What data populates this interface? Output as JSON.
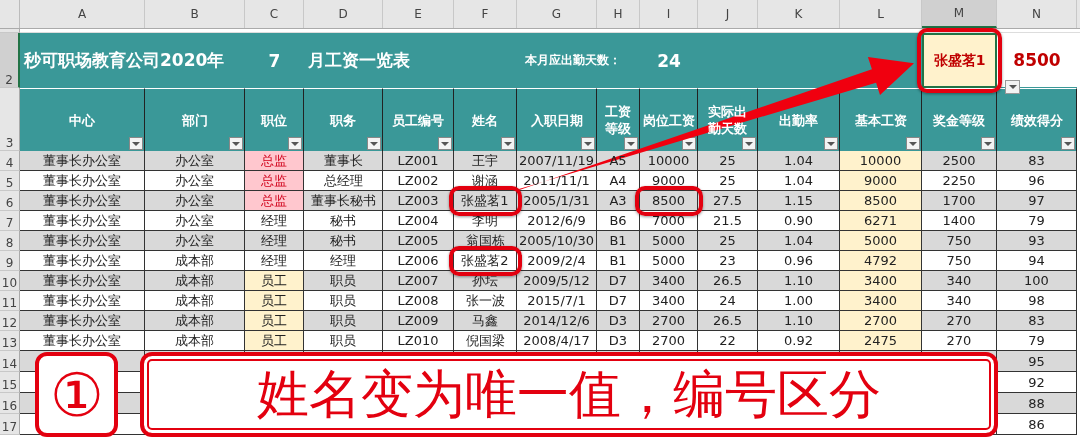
{
  "column_headers": [
    {
      "label": "A",
      "selected": false
    },
    {
      "label": "B",
      "selected": false
    },
    {
      "label": "C",
      "selected": false
    },
    {
      "label": "D",
      "selected": false
    },
    {
      "label": "E",
      "selected": false
    },
    {
      "label": "F",
      "selected": false
    },
    {
      "label": "G",
      "selected": false
    },
    {
      "label": "H",
      "selected": false
    },
    {
      "label": "I",
      "selected": false
    },
    {
      "label": "J",
      "selected": false
    },
    {
      "label": "K",
      "selected": false
    },
    {
      "label": "L",
      "selected": false
    },
    {
      "label": "M",
      "selected": true
    },
    {
      "label": "N",
      "selected": false
    }
  ],
  "title_row": {
    "row_number": "2",
    "selected": true,
    "items": [
      {
        "kind": "title",
        "text": "秒可职场教育公司2020年"
      },
      {
        "kind": "value",
        "text": "7"
      },
      {
        "kind": "title",
        "text": "月工资一览表"
      },
      {
        "kind": "label",
        "text": "本月应出勤天数："
      },
      {
        "kind": "value",
        "text": "24"
      }
    ],
    "lookup_cell": {
      "text": "张盛茗1",
      "selected": true,
      "ringed": true,
      "arrow_to": true
    },
    "result_cell": {
      "text": "8500"
    }
  },
  "header_row": {
    "row_number": "3",
    "columns": [
      "中心",
      "部门",
      "职位",
      "职务",
      "员工编号",
      "姓名",
      "入职日期",
      "工资等级",
      "岗位工资",
      "实际出勤天数",
      "出勤率",
      "基本工资",
      "奖金等级",
      "绩效得分"
    ]
  },
  "rows": [
    {
      "row_number": "4",
      "shaded": true,
      "cells": [
        "董事长办公室",
        "办公室",
        {
          "text": "总监",
          "flagged": true
        },
        "董事长",
        "LZ001",
        "王宇",
        "2007/11/19",
        "A5",
        "10000",
        "25",
        "1.04",
        "10000",
        "2500",
        "83"
      ]
    },
    {
      "row_number": "5",
      "shaded": false,
      "cells": [
        "董事长办公室",
        "办公室",
        {
          "text": "总监",
          "flagged": true
        },
        "总经理",
        "LZ002",
        "谢涵",
        "2011/11/1",
        "A4",
        "9000",
        "25",
        "1.04",
        "9000",
        "2250",
        "96"
      ]
    },
    {
      "row_number": "6",
      "shaded": true,
      "cells": [
        "董事长办公室",
        "办公室",
        {
          "text": "总监",
          "flagged": true
        },
        "董事长秘书",
        "LZ003",
        {
          "text": "张盛茗1",
          "ringed": true,
          "arrow_from": true
        },
        "2005/1/31",
        "A3",
        {
          "text": "8500",
          "ringed": true
        },
        "27.5",
        "1.15",
        "8500",
        "1700",
        "97"
      ]
    },
    {
      "row_number": "7",
      "shaded": false,
      "cells": [
        "董事长办公室",
        "办公室",
        "经理",
        "秘书",
        "LZ004",
        "李明",
        "2012/6/9",
        "B6",
        "7000",
        "21.5",
        "0.90",
        "6271",
        "1400",
        "79"
      ]
    },
    {
      "row_number": "8",
      "shaded": true,
      "cells": [
        "董事长办公室",
        "办公室",
        "经理",
        "秘书",
        "LZ005",
        "翁国栋",
        "2005/10/30",
        "B1",
        "5000",
        "25",
        "1.04",
        "5000",
        "750",
        "93"
      ]
    },
    {
      "row_number": "9",
      "shaded": false,
      "cells": [
        "董事长办公室",
        "成本部",
        "经理",
        "经理",
        "LZ006",
        {
          "text": "张盛茗2",
          "ringed": true
        },
        "2009/2/4",
        "B1",
        "5000",
        "23",
        "0.96",
        "4792",
        "750",
        "94"
      ]
    },
    {
      "row_number": "10",
      "shaded": true,
      "cells": [
        "董事长办公室",
        "成本部",
        {
          "text": "员工",
          "highlighted": true
        },
        "职员",
        "LZ007",
        "孙坛",
        "2009/5/12",
        "D7",
        "3400",
        "26.5",
        "1.10",
        "3400",
        "340",
        "100"
      ]
    },
    {
      "row_number": "11",
      "shaded": false,
      "cells": [
        "董事长办公室",
        "成本部",
        {
          "text": "员工",
          "highlighted": true
        },
        "职员",
        "LZ008",
        "张一波",
        "2015/7/1",
        "D7",
        "3400",
        "24",
        "1.00",
        "3400",
        "340",
        "98"
      ]
    },
    {
      "row_number": "12",
      "shaded": true,
      "cells": [
        "董事长办公室",
        "成本部",
        {
          "text": "员工",
          "highlighted": true
        },
        "职员",
        "LZ009",
        "马鑫",
        "2014/12/6",
        "D3",
        "2700",
        "26.5",
        "1.10",
        "2700",
        "270",
        "83"
      ]
    },
    {
      "row_number": "13",
      "shaded": false,
      "cells": [
        "董事长办公室",
        "成本部",
        {
          "text": "员工",
          "highlighted": true
        },
        "职员",
        "LZ010",
        "倪国梁",
        "2008/4/17",
        "D3",
        "2700",
        "22",
        "0.92",
        "2475",
        "270",
        "79"
      ]
    }
  ],
  "partial_rows": [
    {
      "row_number": "14",
      "shaded": true,
      "last_cell": "95"
    },
    {
      "row_number": "15",
      "shaded": false,
      "last_cell": "92"
    },
    {
      "row_number": "16",
      "shaded": true,
      "last_cell": "88"
    },
    {
      "row_number": "17",
      "shaded": false,
      "last_cell": "86"
    }
  ],
  "caption": {
    "step": "①",
    "text": "姓名变为唯一值，编号区分"
  }
}
